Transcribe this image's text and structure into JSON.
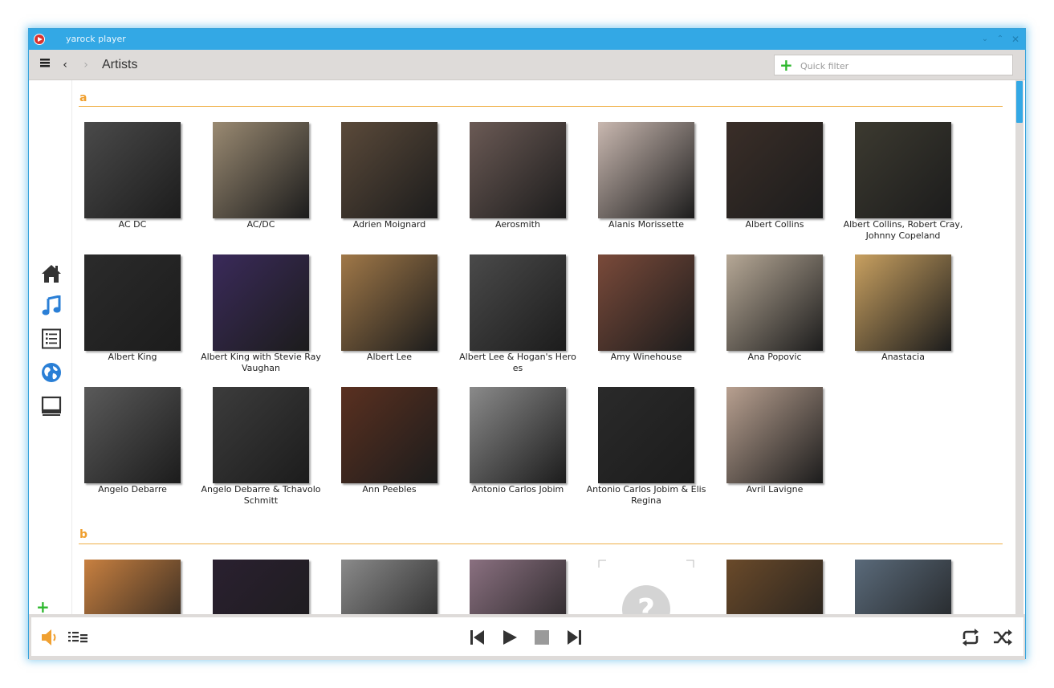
{
  "window": {
    "title": "yarock player"
  },
  "toolbar": {
    "menu_icon": "hamburger-icon",
    "back_icon": "chevron-left-icon",
    "forward_icon": "chevron-right-icon",
    "page_title": "Artists",
    "filter_placeholder": "Quick filter"
  },
  "sidebar": {
    "items": [
      "home-icon",
      "music-icon",
      "playlist-icon",
      "globe-icon",
      "computer-icon"
    ],
    "active": "music-icon"
  },
  "sections": [
    {
      "letter": "a",
      "artists": [
        {
          "name": "AC DC",
          "bg": "#4a4a4a"
        },
        {
          "name": "AC/DC",
          "bg": "#9a8a72"
        },
        {
          "name": "Adrien Moignard",
          "bg": "#5b4a3a"
        },
        {
          "name": "Aerosmith",
          "bg": "#6b5a55"
        },
        {
          "name": "Alanis Morissette",
          "bg": "#c9b8b0"
        },
        {
          "name": "Albert Collins",
          "bg": "#3a2e28"
        },
        {
          "name": "Albert Collins, Robert Cray, Johnny Copeland",
          "bg": "#3c3a30"
        },
        {
          "name": "Albert King",
          "bg": "#2b2b2b"
        },
        {
          "name": "Albert King with Stevie Ray Vaughan",
          "bg": "#3a2a5a"
        },
        {
          "name": "Albert Lee",
          "bg": "#a07848"
        },
        {
          "name": "Albert Lee & Hogan's Heroes",
          "bg": "#4a4a4a"
        },
        {
          "name": "Amy Winehouse",
          "bg": "#7a4a3a"
        },
        {
          "name": "Ana Popovic",
          "bg": "#b6a896"
        },
        {
          "name": "Anastacia",
          "bg": "#c8a060"
        },
        {
          "name": "Angelo Debarre",
          "bg": "#5a5a5a"
        },
        {
          "name": "Angelo Debarre & Tchavolo Schmitt",
          "bg": "#3c3c3c"
        },
        {
          "name": "Ann Peebles",
          "bg": "#5a3020"
        },
        {
          "name": "Antonio Carlos Jobim",
          "bg": "#8a8a8a"
        },
        {
          "name": "Antonio Carlos Jobim & Elis Regina",
          "bg": "#2a2a2a"
        },
        {
          "name": "Avril Lavigne",
          "bg": "#b8a090"
        }
      ]
    },
    {
      "letter": "b",
      "artists": [
        {
          "name": "",
          "bg": "#c88040"
        },
        {
          "name": "",
          "bg": "#2a2030"
        },
        {
          "name": "",
          "bg": "#8a8a8a"
        },
        {
          "name": "",
          "bg": "#8a7080"
        },
        {
          "name": "",
          "bg": "#ffffff",
          "placeholder": true
        },
        {
          "name": "",
          "bg": "#6a4a2a"
        },
        {
          "name": "",
          "bg": "#5a6a7a"
        }
      ]
    }
  ],
  "player": {
    "volume_icon": "speaker-icon",
    "playqueue_icon": "playqueue-icon",
    "prev_icon": "skip-back-icon",
    "play_icon": "play-icon",
    "stop_icon": "stop-icon",
    "next_icon": "skip-forward-icon",
    "repeat_icon": "repeat-icon",
    "shuffle_icon": "shuffle-icon"
  },
  "colors": {
    "accent": "#33a8e5",
    "section": "#f0a030",
    "add": "#2eb82e",
    "volume": "#f0a030"
  }
}
